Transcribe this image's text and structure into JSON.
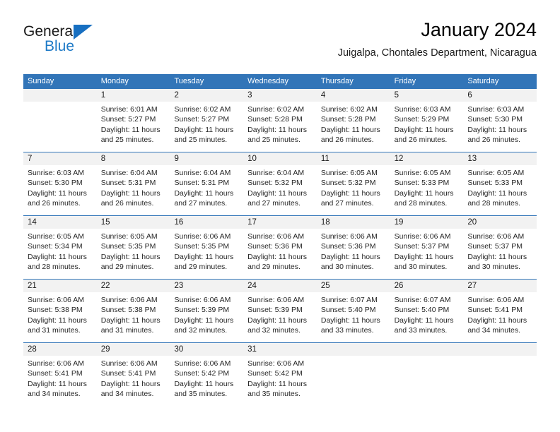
{
  "brand": {
    "name_top": "General",
    "name_bottom": "Blue",
    "logo_icon": "blue-triangle-icon",
    "accent_color": "#1e7ac7"
  },
  "header": {
    "title": "January 2024",
    "subtitle": "Juigalpa, Chontales Department, Nicaragua"
  },
  "calendar": {
    "header_bg": "#3275b8",
    "day_band_bg": "#f2f2f2",
    "weekday_headers": [
      "Sunday",
      "Monday",
      "Tuesday",
      "Wednesday",
      "Thursday",
      "Friday",
      "Saturday"
    ],
    "weeks": [
      {
        "days": [
          {
            "date": "",
            "sunrise": "",
            "sunset": "",
            "daylight_line1": "",
            "daylight_line2": "",
            "empty": true
          },
          {
            "date": "1",
            "sunrise": "Sunrise: 6:01 AM",
            "sunset": "Sunset: 5:27 PM",
            "daylight_line1": "Daylight: 11 hours",
            "daylight_line2": "and 25 minutes.",
            "empty": false
          },
          {
            "date": "2",
            "sunrise": "Sunrise: 6:02 AM",
            "sunset": "Sunset: 5:27 PM",
            "daylight_line1": "Daylight: 11 hours",
            "daylight_line2": "and 25 minutes.",
            "empty": false
          },
          {
            "date": "3",
            "sunrise": "Sunrise: 6:02 AM",
            "sunset": "Sunset: 5:28 PM",
            "daylight_line1": "Daylight: 11 hours",
            "daylight_line2": "and 25 minutes.",
            "empty": false
          },
          {
            "date": "4",
            "sunrise": "Sunrise: 6:02 AM",
            "sunset": "Sunset: 5:28 PM",
            "daylight_line1": "Daylight: 11 hours",
            "daylight_line2": "and 26 minutes.",
            "empty": false
          },
          {
            "date": "5",
            "sunrise": "Sunrise: 6:03 AM",
            "sunset": "Sunset: 5:29 PM",
            "daylight_line1": "Daylight: 11 hours",
            "daylight_line2": "and 26 minutes.",
            "empty": false
          },
          {
            "date": "6",
            "sunrise": "Sunrise: 6:03 AM",
            "sunset": "Sunset: 5:30 PM",
            "daylight_line1": "Daylight: 11 hours",
            "daylight_line2": "and 26 minutes.",
            "empty": false
          }
        ]
      },
      {
        "days": [
          {
            "date": "7",
            "sunrise": "Sunrise: 6:03 AM",
            "sunset": "Sunset: 5:30 PM",
            "daylight_line1": "Daylight: 11 hours",
            "daylight_line2": "and 26 minutes.",
            "empty": false
          },
          {
            "date": "8",
            "sunrise": "Sunrise: 6:04 AM",
            "sunset": "Sunset: 5:31 PM",
            "daylight_line1": "Daylight: 11 hours",
            "daylight_line2": "and 26 minutes.",
            "empty": false
          },
          {
            "date": "9",
            "sunrise": "Sunrise: 6:04 AM",
            "sunset": "Sunset: 5:31 PM",
            "daylight_line1": "Daylight: 11 hours",
            "daylight_line2": "and 27 minutes.",
            "empty": false
          },
          {
            "date": "10",
            "sunrise": "Sunrise: 6:04 AM",
            "sunset": "Sunset: 5:32 PM",
            "daylight_line1": "Daylight: 11 hours",
            "daylight_line2": "and 27 minutes.",
            "empty": false
          },
          {
            "date": "11",
            "sunrise": "Sunrise: 6:05 AM",
            "sunset": "Sunset: 5:32 PM",
            "daylight_line1": "Daylight: 11 hours",
            "daylight_line2": "and 27 minutes.",
            "empty": false
          },
          {
            "date": "12",
            "sunrise": "Sunrise: 6:05 AM",
            "sunset": "Sunset: 5:33 PM",
            "daylight_line1": "Daylight: 11 hours",
            "daylight_line2": "and 28 minutes.",
            "empty": false
          },
          {
            "date": "13",
            "sunrise": "Sunrise: 6:05 AM",
            "sunset": "Sunset: 5:33 PM",
            "daylight_line1": "Daylight: 11 hours",
            "daylight_line2": "and 28 minutes.",
            "empty": false
          }
        ]
      },
      {
        "days": [
          {
            "date": "14",
            "sunrise": "Sunrise: 6:05 AM",
            "sunset": "Sunset: 5:34 PM",
            "daylight_line1": "Daylight: 11 hours",
            "daylight_line2": "and 28 minutes.",
            "empty": false
          },
          {
            "date": "15",
            "sunrise": "Sunrise: 6:05 AM",
            "sunset": "Sunset: 5:35 PM",
            "daylight_line1": "Daylight: 11 hours",
            "daylight_line2": "and 29 minutes.",
            "empty": false
          },
          {
            "date": "16",
            "sunrise": "Sunrise: 6:06 AM",
            "sunset": "Sunset: 5:35 PM",
            "daylight_line1": "Daylight: 11 hours",
            "daylight_line2": "and 29 minutes.",
            "empty": false
          },
          {
            "date": "17",
            "sunrise": "Sunrise: 6:06 AM",
            "sunset": "Sunset: 5:36 PM",
            "daylight_line1": "Daylight: 11 hours",
            "daylight_line2": "and 29 minutes.",
            "empty": false
          },
          {
            "date": "18",
            "sunrise": "Sunrise: 6:06 AM",
            "sunset": "Sunset: 5:36 PM",
            "daylight_line1": "Daylight: 11 hours",
            "daylight_line2": "and 30 minutes.",
            "empty": false
          },
          {
            "date": "19",
            "sunrise": "Sunrise: 6:06 AM",
            "sunset": "Sunset: 5:37 PM",
            "daylight_line1": "Daylight: 11 hours",
            "daylight_line2": "and 30 minutes.",
            "empty": false
          },
          {
            "date": "20",
            "sunrise": "Sunrise: 6:06 AM",
            "sunset": "Sunset: 5:37 PM",
            "daylight_line1": "Daylight: 11 hours",
            "daylight_line2": "and 30 minutes.",
            "empty": false
          }
        ]
      },
      {
        "days": [
          {
            "date": "21",
            "sunrise": "Sunrise: 6:06 AM",
            "sunset": "Sunset: 5:38 PM",
            "daylight_line1": "Daylight: 11 hours",
            "daylight_line2": "and 31 minutes.",
            "empty": false
          },
          {
            "date": "22",
            "sunrise": "Sunrise: 6:06 AM",
            "sunset": "Sunset: 5:38 PM",
            "daylight_line1": "Daylight: 11 hours",
            "daylight_line2": "and 31 minutes.",
            "empty": false
          },
          {
            "date": "23",
            "sunrise": "Sunrise: 6:06 AM",
            "sunset": "Sunset: 5:39 PM",
            "daylight_line1": "Daylight: 11 hours",
            "daylight_line2": "and 32 minutes.",
            "empty": false
          },
          {
            "date": "24",
            "sunrise": "Sunrise: 6:06 AM",
            "sunset": "Sunset: 5:39 PM",
            "daylight_line1": "Daylight: 11 hours",
            "daylight_line2": "and 32 minutes.",
            "empty": false
          },
          {
            "date": "25",
            "sunrise": "Sunrise: 6:07 AM",
            "sunset": "Sunset: 5:40 PM",
            "daylight_line1": "Daylight: 11 hours",
            "daylight_line2": "and 33 minutes.",
            "empty": false
          },
          {
            "date": "26",
            "sunrise": "Sunrise: 6:07 AM",
            "sunset": "Sunset: 5:40 PM",
            "daylight_line1": "Daylight: 11 hours",
            "daylight_line2": "and 33 minutes.",
            "empty": false
          },
          {
            "date": "27",
            "sunrise": "Sunrise: 6:06 AM",
            "sunset": "Sunset: 5:41 PM",
            "daylight_line1": "Daylight: 11 hours",
            "daylight_line2": "and 34 minutes.",
            "empty": false
          }
        ]
      },
      {
        "days": [
          {
            "date": "28",
            "sunrise": "Sunrise: 6:06 AM",
            "sunset": "Sunset: 5:41 PM",
            "daylight_line1": "Daylight: 11 hours",
            "daylight_line2": "and 34 minutes.",
            "empty": false
          },
          {
            "date": "29",
            "sunrise": "Sunrise: 6:06 AM",
            "sunset": "Sunset: 5:41 PM",
            "daylight_line1": "Daylight: 11 hours",
            "daylight_line2": "and 34 minutes.",
            "empty": false
          },
          {
            "date": "30",
            "sunrise": "Sunrise: 6:06 AM",
            "sunset": "Sunset: 5:42 PM",
            "daylight_line1": "Daylight: 11 hours",
            "daylight_line2": "and 35 minutes.",
            "empty": false
          },
          {
            "date": "31",
            "sunrise": "Sunrise: 6:06 AM",
            "sunset": "Sunset: 5:42 PM",
            "daylight_line1": "Daylight: 11 hours",
            "daylight_line2": "and 35 minutes.",
            "empty": false
          },
          {
            "date": "",
            "sunrise": "",
            "sunset": "",
            "daylight_line1": "",
            "daylight_line2": "",
            "empty": true
          },
          {
            "date": "",
            "sunrise": "",
            "sunset": "",
            "daylight_line1": "",
            "daylight_line2": "",
            "empty": true
          },
          {
            "date": "",
            "sunrise": "",
            "sunset": "",
            "daylight_line1": "",
            "daylight_line2": "",
            "empty": true
          }
        ]
      }
    ]
  }
}
